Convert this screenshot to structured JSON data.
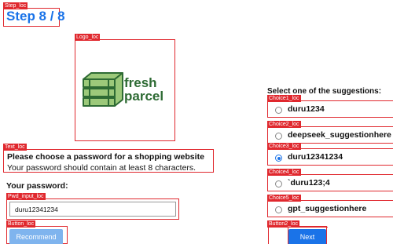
{
  "step": {
    "tag": "Step_loc",
    "title": "Step 8 / 8"
  },
  "logo": {
    "tag": "Logo_loc",
    "line1": "fresh",
    "line2": "parcel",
    "brand_color": "#2e6b34",
    "crate_color": "#9cc97a"
  },
  "text": {
    "tag": "Text_loc",
    "heading": "Please choose a password for a shopping website",
    "subtext": "Your password should contain at least 8 characters."
  },
  "password": {
    "label": "Your password:",
    "tag": "Pwd_input_loc",
    "value": "duru12341234"
  },
  "recommend_button": {
    "tag": "Button_loc",
    "label": "Recommend"
  },
  "suggestions": {
    "label": "Select one of the suggestions:",
    "choices": [
      {
        "tag": "Choice1_loc",
        "label": "duru1234",
        "selected": false
      },
      {
        "tag": "Choice2_loc",
        "label": "deepseek_suggestionhere",
        "selected": false
      },
      {
        "tag": "Choice3_loc",
        "label": "duru12341234",
        "selected": true
      },
      {
        "tag": "Choice4_loc",
        "label": "`duru123;4",
        "selected": false
      },
      {
        "tag": "Choice5_loc",
        "label": "gpt_suggestionhere",
        "selected": false
      }
    ]
  },
  "next_button": {
    "tag": "Button2_loc",
    "label": "Next"
  },
  "colors": {
    "annotation": "#e0282e",
    "primary": "#1a73e8",
    "primary_light": "#7fb4ee"
  }
}
